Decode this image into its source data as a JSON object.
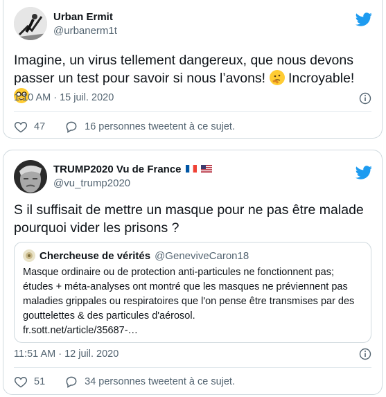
{
  "tweets": [
    {
      "author": "Urban Ermit",
      "handle": "@urbanerm1t",
      "text_main": "Imagine, un virus tellement dangereux, que nous devons passer un test pour savoir si nous l’avons!",
      "text_mid": "Incroyable!",
      "emojis": [
        "thinking-face",
        "nerd-face"
      ],
      "timestamp": "1:10 AM · 15 juil. 2020",
      "likes": "47",
      "retweet_text": "16 personnes tweetent à ce sujet."
    },
    {
      "author": "TRUMP2020 Vu de France",
      "author_flags": [
        "fr",
        "us"
      ],
      "handle": "@vu_trump2020",
      "text_main": "S il suffisait de mettre un masque pour ne pas être malade pourquoi vider les prisons ?",
      "quote": {
        "author": "Chercheuse de vérités",
        "handle": "@GeneviveCaron18",
        "text": "Masque ordinaire ou de protection anti-particules ne fonctionnent pas; études + méta-analyses ont montré que les masques ne préviennent pas maladies grippales ou respiratoires que l'on pense être transmises par des gouttelettes & des particules d'aérosol.",
        "link": "fr.sott.net/article/35687-…"
      },
      "timestamp": "11:51 AM · 12 juil. 2020",
      "likes": "51",
      "retweet_text": "34 personnes tweetent à ce sujet."
    }
  ],
  "colors": {
    "twitter_blue": "#1d9bf0",
    "muted": "#536471",
    "border": "#cfd9de"
  }
}
